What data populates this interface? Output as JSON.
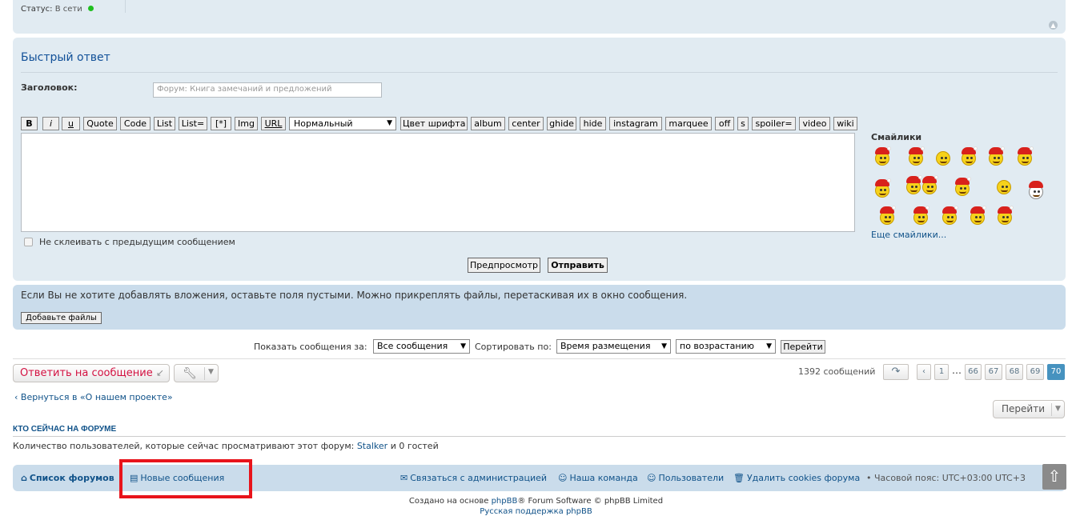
{
  "profile": {
    "status_label": "Статус:",
    "status_value": "В сети"
  },
  "quick_reply": {
    "title": "Быстрый ответ",
    "subject_label": "Заголовок:",
    "subject_value": "Форум: Книга замечаний и предложений",
    "toolbar": [
      "B",
      "i",
      "u",
      "Quote",
      "Code",
      "List",
      "List=",
      "[*]",
      "Img",
      "URL"
    ],
    "font_size_select": "Нормальный",
    "toolbar2": [
      "Цвет шрифта",
      "album",
      "center",
      "ghide",
      "hide",
      "instagram",
      "marquee",
      "off",
      "s",
      "spoiler=",
      "video",
      "wiki"
    ],
    "no_merge_label": "Не склеивать с предыдущим сообщением",
    "preview_label": "Предпросмотр",
    "submit_label": "Отправить",
    "smilies_label": "Смайлики",
    "more_smilies": "Еще смайлики..."
  },
  "attachments": {
    "info": "Если Вы не хотите добавлять вложения, оставьте поля пустыми. Можно прикреплять файлы, перетаскивая их в окно сообщения.",
    "add_files": "Добавьте файлы"
  },
  "sort": {
    "show_label": "Показать сообщения за:",
    "show_value": "Все сообщения",
    "sort_label": "Сортировать по:",
    "sort_value": "Время размещения",
    "order_value": "по возрастанию",
    "go_label": "Перейти"
  },
  "actions": {
    "reply_label": "Ответить на сообщение",
    "post_count": "1392 сообщений",
    "pages": [
      "1",
      "66",
      "67",
      "68",
      "69",
      "70"
    ],
    "ellipsis": "…",
    "active_page": "70",
    "return_link": "Вернуться в «О нашем проекте»",
    "jump_label": "Перейти"
  },
  "who_online": {
    "title": "КТО СЕЙЧАС НА ФОРУМЕ",
    "text_prefix": "Количество пользователей, которые сейчас просматривают этот форум: ",
    "user": "Stalker",
    "text_suffix": " и 0 гостей"
  },
  "footer_nav": {
    "home": "Список форумов",
    "new_posts": "Новые сообщения",
    "contact": "Связаться с администрацией",
    "team": "Наша команда",
    "members": "Пользователи",
    "delete_cookies": "Удалить cookies форума",
    "timezone": "Часовой пояс: UTC+03:00 UTC+3"
  },
  "copyright": {
    "prefix": "Создано на основе ",
    "phpbb": "phpBB",
    "suffix": "® Forum Software © phpBB Limited",
    "ru_support": "Русская поддержка phpBB"
  },
  "colors": {
    "panel_bg": "#e1ebf2",
    "panel_bg_dark": "#cadceb",
    "link": "#105289",
    "reply_text": "#d31141",
    "active_page": "#4692bf",
    "highlight": "#e8141b"
  }
}
